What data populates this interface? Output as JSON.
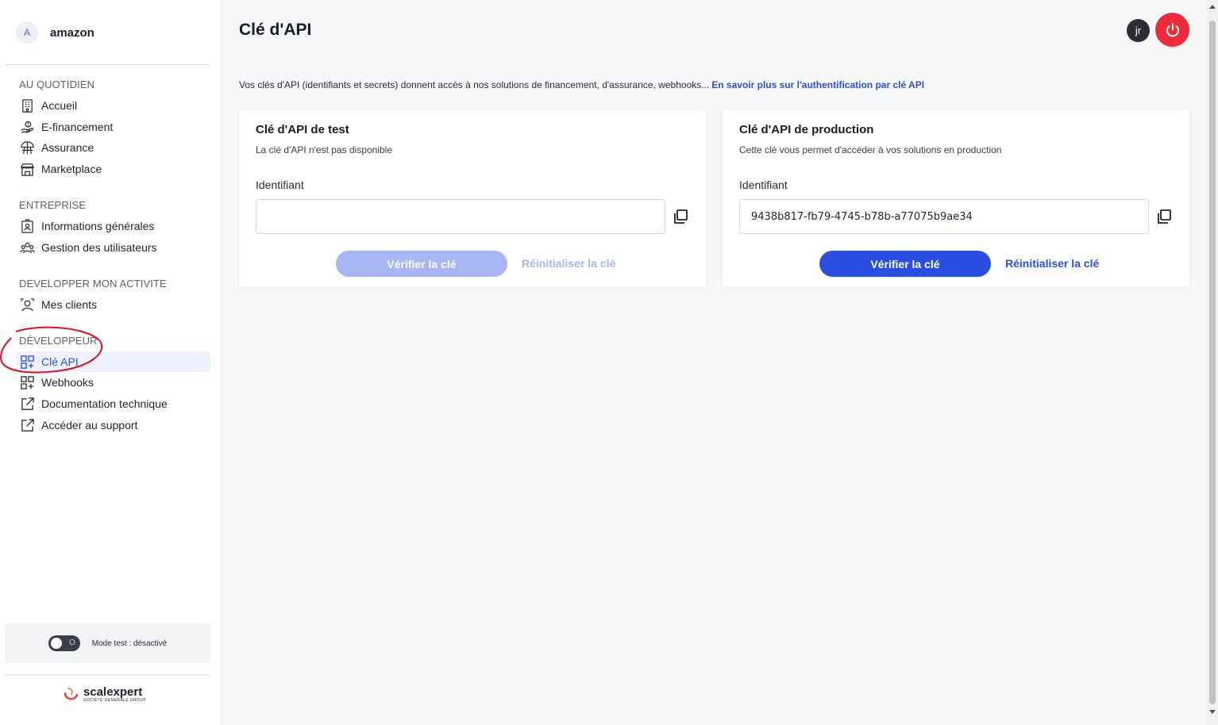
{
  "sidebar": {
    "account": {
      "avatar_letter": "A",
      "name": "amazon"
    },
    "sections": [
      {
        "title": "AU QUOTIDIEN",
        "items": [
          {
            "label": "Accueil",
            "icon": "building-icon"
          },
          {
            "label": "E-financement",
            "icon": "hand-money-icon"
          },
          {
            "label": "Assurance",
            "icon": "umbrella-icon"
          },
          {
            "label": "Marketplace",
            "icon": "store-icon"
          }
        ]
      },
      {
        "title": "ENTREPRISE",
        "items": [
          {
            "label": "Informations générales",
            "icon": "id-card-icon"
          },
          {
            "label": "Gestion des utilisateurs",
            "icon": "users-icon"
          }
        ]
      },
      {
        "title": "DEVELOPPER MON ACTIVITE",
        "items": [
          {
            "label": "Mes clients",
            "icon": "client-icon"
          }
        ]
      },
      {
        "title": "DÉVELOPPEUR",
        "items": [
          {
            "label": "Clé API",
            "icon": "api-grid-icon",
            "active": true
          },
          {
            "label": "Webhooks",
            "icon": "api-grid-icon"
          },
          {
            "label": "Documentation technique",
            "icon": "external-link-icon"
          },
          {
            "label": "Accéder au support",
            "icon": "external-link-icon"
          }
        ]
      }
    ],
    "mode_toggle": {
      "label": "Mode test : désactivé",
      "state": "off",
      "knob_text": "O"
    },
    "logo": {
      "brand": "scalexpert",
      "sub": "SOCIETE GENERALE GROUP"
    }
  },
  "header": {
    "title": "Clé d'API",
    "user_initials": "jr",
    "power_icon": "power-icon"
  },
  "intro": {
    "text": "Vos clés d'API (identifiants et secrets) donnent accès à nos solutions de financement, d'assurance, webhooks...",
    "link": "En savoir plus sur l'authentification par clé API"
  },
  "cards": {
    "test": {
      "title": "Clé d'API de test",
      "description": "La clé d'API n'est pas disponible",
      "field_label": "Identifiant",
      "field_value": "",
      "verify_label": "Vérifier la clé",
      "reset_label": "Réinitialiser la clé",
      "enabled": false
    },
    "production": {
      "title": "Clé d'API de production",
      "description": "Cette clé vous permet d'accéder à vos solutions en production",
      "field_label": "Identifiant",
      "field_value": "9438b817-fb79-4745-b78b-a77075b9ae34",
      "verify_label": "Vérifier la clé",
      "reset_label": "Réinitialiser la clé",
      "enabled": true
    }
  },
  "colors": {
    "accent": "#2a4fe0",
    "accent_disabled": "#a7b6f3",
    "power": "#ee2b3b",
    "annotation": "#e0101e"
  }
}
